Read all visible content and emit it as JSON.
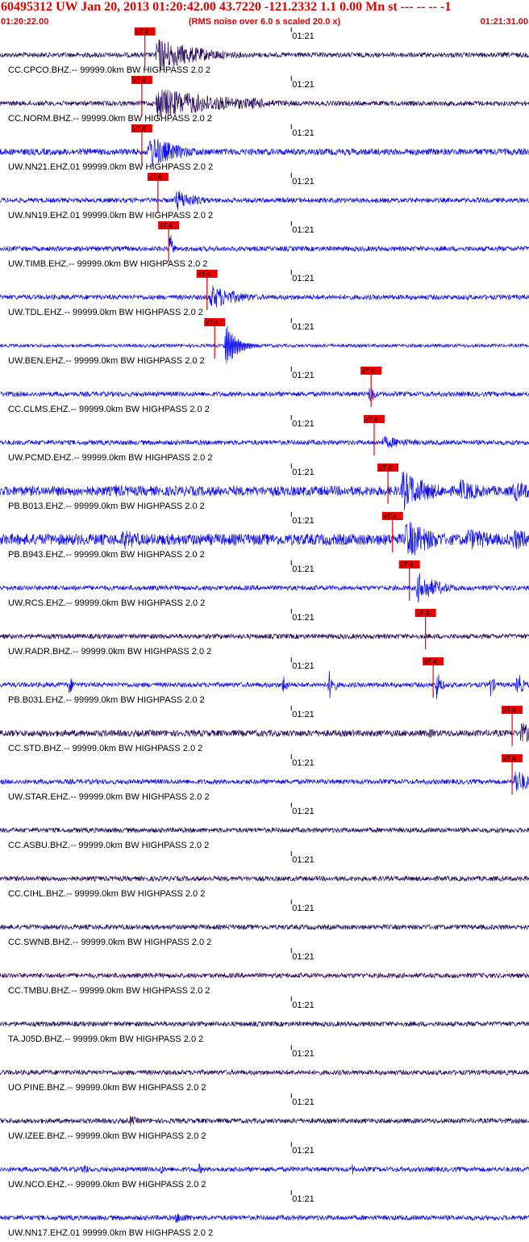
{
  "header": {
    "title": "60495312 UW Jan 20, 2013 01:20:42.00   43.7220 -121.2332  1.1 0.00 Mn st --- -- --  -1",
    "start_time": "01:20:22.00",
    "rms_note": "(RMS noise over 6.0 s scaled 20.0 x)",
    "end_time": "01:21:31.00"
  },
  "colors": {
    "title": "#e00000",
    "pick": "#ee0000",
    "trace_blue": "#1010ee",
    "trace_dark": "#2a0a5e",
    "label": "#000000"
  },
  "chart_data": {
    "type": "line",
    "x_start": "01:20:22.00",
    "x_end": "01:21:31.00",
    "minute_mark": "01:21",
    "pick_label": "xT 4",
    "trace_suffix": "99999.0km BW  HIGHPASS  2.0  2",
    "traces": [
      {
        "label": "CC.CPCO.BHZ.--",
        "color": "dark",
        "amp": 3,
        "pick_s": 18.9,
        "events": [
          {
            "t": 20.5,
            "a": 22,
            "d": 6,
            "f": 1.5
          }
        ]
      },
      {
        "label": "CC.NORM.BHZ.--",
        "color": "dark",
        "amp": 3,
        "pick_s": 18.5,
        "events": [
          {
            "t": 20.5,
            "a": 20,
            "d": 10,
            "f": 1.5
          },
          {
            "t": 33.0,
            "a": 8,
            "d": 4,
            "f": 1.5
          }
        ]
      },
      {
        "label": "UW.NN21.EHZ.01",
        "color": "blue",
        "amp": 4,
        "pick_s": 18.5,
        "events": [
          {
            "t": 19.5,
            "a": 22,
            "d": 4,
            "f": 1.5
          },
          {
            "t": 71.5,
            "a": 12,
            "d": 0.5,
            "f": 1
          }
        ]
      },
      {
        "label": "UW.NN19.EHZ.01",
        "color": "blue",
        "amp": 3,
        "pick_s": 20.6,
        "events": [
          {
            "t": 23.0,
            "a": 14,
            "d": 3,
            "f": 1.5
          }
        ]
      },
      {
        "label": "UW.TIMB.EHZ.--",
        "color": "blue",
        "amp": 3,
        "pick_s": 22.0,
        "events": [
          {
            "t": 22.2,
            "a": 22,
            "d": 0.4,
            "f": 1
          }
        ]
      },
      {
        "label": "UW.TDL.EHZ.--",
        "color": "blue",
        "amp": 3,
        "pick_s": 27.0,
        "events": [
          {
            "t": 27.5,
            "a": 16,
            "d": 4,
            "f": 1.5
          }
        ]
      },
      {
        "label": "UW.BEN.EHZ.--",
        "color": "blue",
        "amp": 2,
        "pick_s": 28.0,
        "events": [
          {
            "t": 29.5,
            "a": 28,
            "d": 1.6,
            "f": 0.25
          }
        ]
      },
      {
        "label": "CC.CLMS.EHZ.--",
        "color": "blue",
        "amp": 3,
        "pick_s": 48.4,
        "events": [
          {
            "t": 48.3,
            "a": 16,
            "d": 0.6,
            "f": 1
          }
        ]
      },
      {
        "label": "UW.PCMD.EHZ.--",
        "color": "blue",
        "amp": 3,
        "pick_s": 48.8,
        "events": [
          {
            "t": 50.0,
            "a": 8,
            "d": 5,
            "f": 1.5
          }
        ]
      },
      {
        "label": "PB.B013.EHZ.--",
        "color": "blue",
        "amp": 6,
        "pick_s": 50.6,
        "events": [
          {
            "t": 15.0,
            "a": 9,
            "d": 3,
            "f": 1.5
          },
          {
            "t": 52.5,
            "a": 26,
            "d": 4,
            "f": 1.5
          },
          {
            "t": 60.0,
            "a": 15,
            "d": 4,
            "f": 1.5
          },
          {
            "t": 67.0,
            "a": 14,
            "d": 4,
            "f": 1.5
          }
        ]
      },
      {
        "label": "PB.B943.EHZ.--",
        "color": "blue",
        "amp": 7,
        "pick_s": 51.2,
        "events": [
          {
            "t": 16.0,
            "a": 13,
            "d": 4,
            "f": 1.5
          },
          {
            "t": 53.0,
            "a": 26,
            "d": 4,
            "f": 1.5
          },
          {
            "t": 61.0,
            "a": 15,
            "d": 5,
            "f": 1.5
          },
          {
            "t": 67.0,
            "a": 14,
            "d": 5,
            "f": 1.5
          }
        ]
      },
      {
        "label": "UW.RCS.EHZ.--",
        "color": "blue",
        "amp": 3,
        "pick_s": 53.4,
        "events": [
          {
            "t": 54.5,
            "a": 20,
            "d": 3,
            "f": 1.5
          }
        ]
      },
      {
        "label": "UW.RADR.BHZ.--",
        "color": "dark",
        "amp": 3,
        "pick_s": 55.5,
        "events": []
      },
      {
        "label": "PB.B031.EHZ.--",
        "color": "blue",
        "amp": 3,
        "pick_s": 56.5,
        "events": [
          {
            "t": 9.0,
            "a": 14,
            "d": 0.6,
            "f": 1
          },
          {
            "t": 37.0,
            "a": 14,
            "d": 0.6,
            "f": 1
          },
          {
            "t": 43.0,
            "a": 20,
            "d": 0.7,
            "f": 1
          },
          {
            "t": 57.0,
            "a": 22,
            "d": 0.6,
            "f": 1
          },
          {
            "t": 64.0,
            "a": 15,
            "d": 0.6,
            "f": 1
          },
          {
            "t": 67.5,
            "a": 18,
            "d": 0.8,
            "f": 1
          }
        ]
      },
      {
        "label": "CC.STD.BHZ.--",
        "color": "dark",
        "amp": 4,
        "pick_s": 66.8,
        "events": [
          {
            "t": 56.0,
            "a": 6,
            "d": 3,
            "f": 1.5
          },
          {
            "t": 68.0,
            "a": 14,
            "d": 3,
            "f": 1.5
          }
        ]
      },
      {
        "label": "UW.STAR.EHZ.--",
        "color": "blue",
        "amp": 3,
        "pick_s": 66.8,
        "events": [
          {
            "t": 67.2,
            "a": 18,
            "d": 2,
            "f": 1.5
          }
        ]
      },
      {
        "label": "CC.ASBU.BHZ.--",
        "color": "dark",
        "amp": 3,
        "pick_s": null,
        "events": []
      },
      {
        "label": "CC.CIHL.BHZ.--",
        "color": "dark",
        "amp": 3,
        "pick_s": null,
        "events": []
      },
      {
        "label": "CC.SWNB.BHZ.--",
        "color": "dark",
        "amp": 3,
        "pick_s": null,
        "events": []
      },
      {
        "label": "CC.TMBU.BHZ.--",
        "color": "dark",
        "amp": 3,
        "pick_s": null,
        "events": []
      },
      {
        "label": "TA.J05D.BHZ.--",
        "color": "dark",
        "amp": 3,
        "pick_s": null,
        "events": []
      },
      {
        "label": "UO.PINE.BHZ.--",
        "color": "dark",
        "amp": 3,
        "pick_s": null,
        "events": []
      },
      {
        "label": "UW.IZEE.BHZ.--",
        "color": "dark",
        "amp": 3,
        "pick_s": null,
        "events": [
          {
            "t": 17.0,
            "a": 7,
            "d": 1.5,
            "f": 1.5
          }
        ]
      },
      {
        "label": "UW.NCO.EHZ.--",
        "color": "blue",
        "amp": 3,
        "pick_s": null,
        "events": [
          {
            "t": 11.0,
            "a": 10,
            "d": 0.5,
            "f": 1
          },
          {
            "t": 21.0,
            "a": 8,
            "d": 0.5,
            "f": 1
          },
          {
            "t": 26.0,
            "a": 8,
            "d": 0.5,
            "f": 1
          },
          {
            "t": 46.0,
            "a": 7,
            "d": 0.5,
            "f": 1
          }
        ]
      },
      {
        "label": "UW.NN17.EHZ.01",
        "color": "blue",
        "amp": 3,
        "pick_s": null,
        "events": [
          {
            "t": 23.0,
            "a": 7,
            "d": 3,
            "f": 1.5
          }
        ]
      }
    ]
  }
}
